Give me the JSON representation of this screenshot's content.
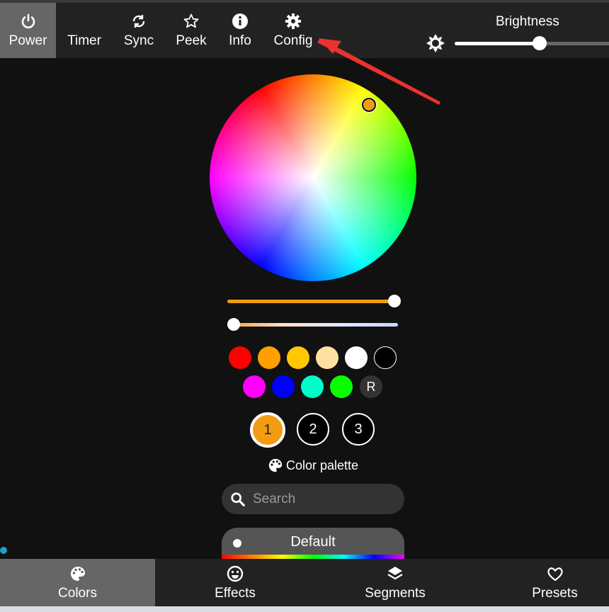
{
  "topbar": {
    "buttons": [
      {
        "label": "Power",
        "icon": "power-icon",
        "active": true
      },
      {
        "label": "Timer",
        "icon": "moon-icon"
      },
      {
        "label": "Sync",
        "icon": "sync-icon"
      },
      {
        "label": "Peek",
        "icon": "star-icon"
      },
      {
        "label": "Info",
        "icon": "info-icon"
      },
      {
        "label": "Config",
        "icon": "gear-icon"
      }
    ],
    "brightness_label": "Brightness",
    "brightness_value": 0.55
  },
  "colors": {
    "accent": "#f39c12",
    "quick_colors": [
      "#ff0000",
      "#ffa000",
      "#ffc800",
      "#ffe0a0",
      "#ffffff",
      "#000000",
      "#ff00ff",
      "#0000ff",
      "#00ffc8",
      "#08ff00"
    ],
    "random_label": "R",
    "slots": [
      "1",
      "2",
      "3"
    ]
  },
  "palette": {
    "label": "Color palette",
    "search_placeholder": "Search",
    "selected": "Default"
  },
  "bottombar": {
    "tabs": [
      {
        "label": "Colors",
        "icon": "palette-icon",
        "active": true
      },
      {
        "label": "Effects",
        "icon": "smiley-icon"
      },
      {
        "label": "Segments",
        "icon": "layers-icon"
      },
      {
        "label": "Presets",
        "icon": "heart-icon"
      }
    ]
  }
}
